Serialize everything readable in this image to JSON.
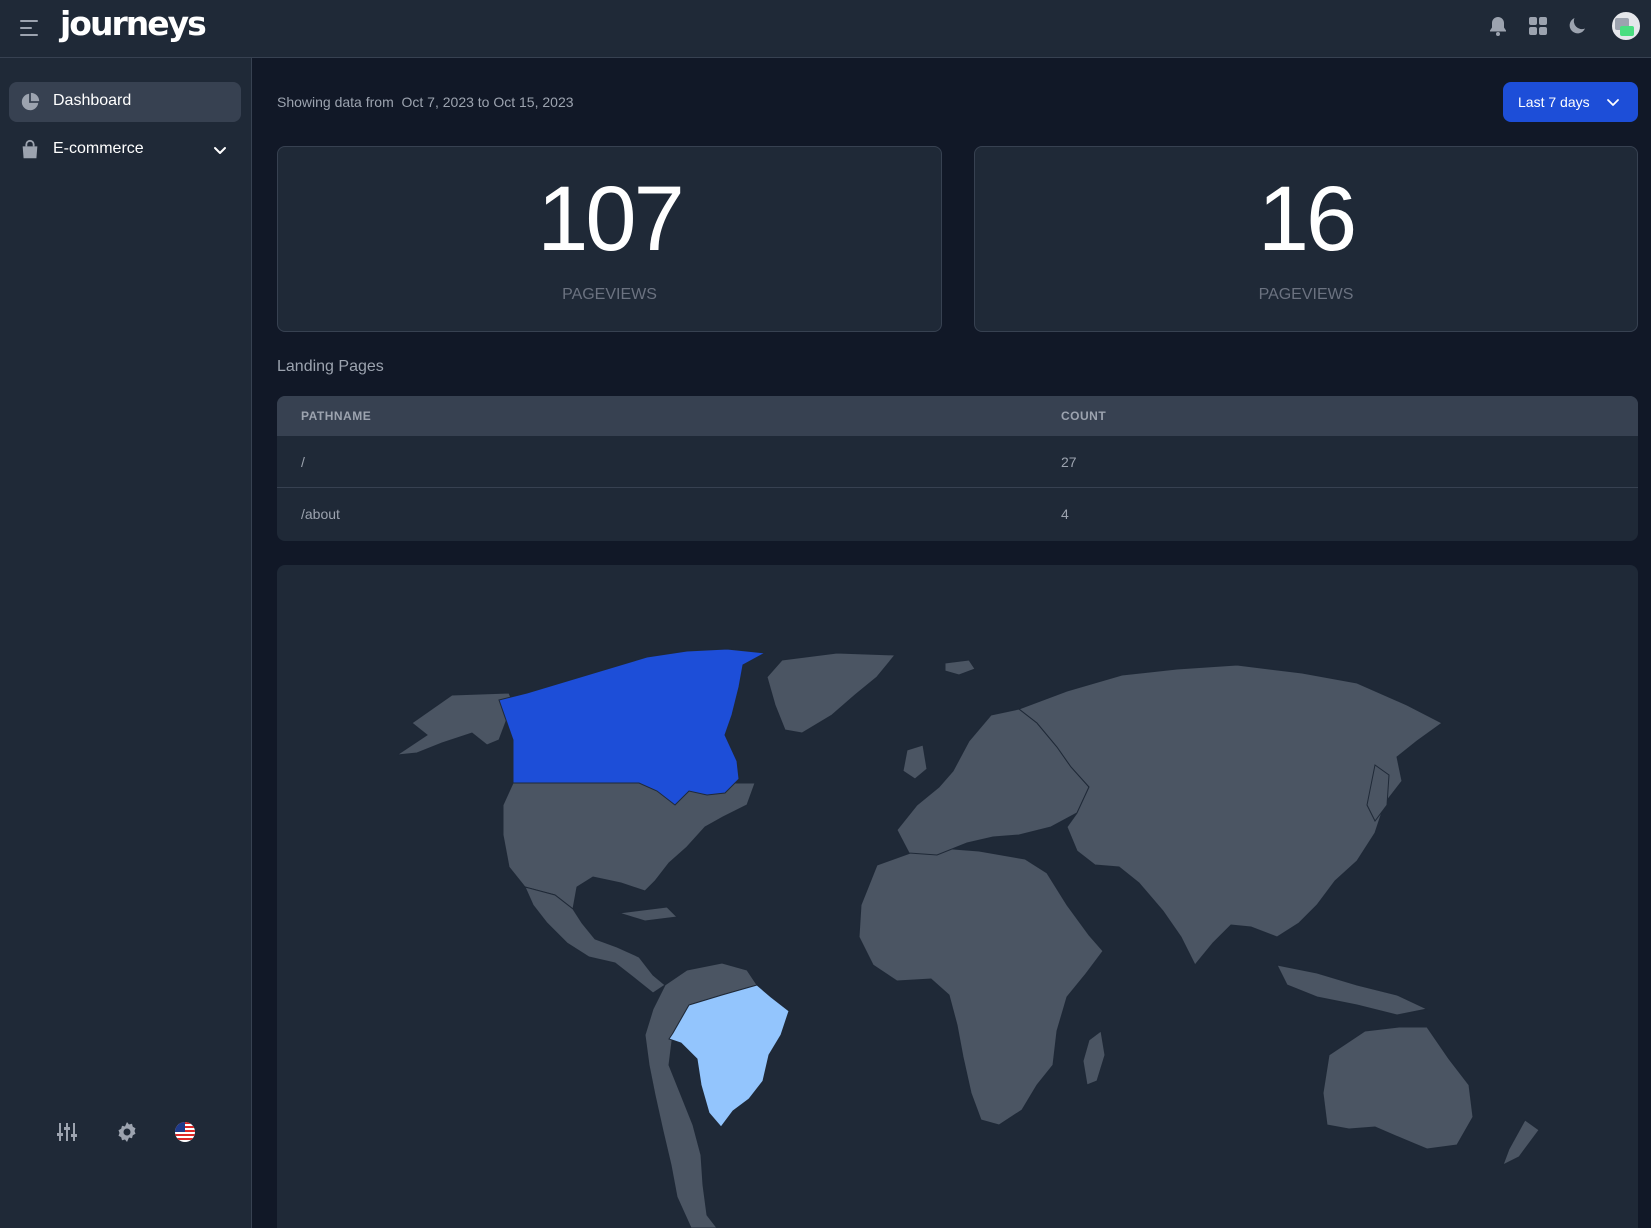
{
  "app": {
    "logo_text": "journeys",
    "icons": [
      "menu-icon",
      "bell-icon",
      "apps-grid-icon",
      "moon-icon",
      "avatar"
    ]
  },
  "sidebar": {
    "items": [
      {
        "label": "Dashboard",
        "icon": "pie-chart-icon",
        "active": true
      },
      {
        "label": "E-commerce",
        "icon": "shopping-bag-icon",
        "active": false,
        "expandable": true
      }
    ],
    "bottom_icons": [
      "sliders-icon",
      "gear-icon",
      "us-flag-icon"
    ]
  },
  "header": {
    "prefix": "Showing data from",
    "range": "Oct 7, 2023 to Oct 15, 2023",
    "date_button_label": "Last 7 days"
  },
  "stats": [
    {
      "value": "107",
      "label": "PAGEVIEWS"
    },
    {
      "value": "16",
      "label": "PAGEVIEWS"
    }
  ],
  "landing_pages": {
    "title": "Landing Pages",
    "columns": [
      "PATHNAME",
      "COUNT"
    ],
    "rows": [
      {
        "pathname": "/",
        "count": "27"
      },
      {
        "pathname": "/about",
        "count": "4"
      }
    ]
  },
  "map": {
    "highlighted": [
      {
        "country": "Canada",
        "color": "#1d4ed8"
      },
      {
        "country": "Brazil",
        "color": "#93c5fd"
      }
    ],
    "land_color": "#4b5563",
    "ocean_color": "#1f2937"
  },
  "colors": {
    "accent": "#1d4ed8",
    "background": "#111827",
    "panel": "#1f2937",
    "border": "#374151"
  }
}
